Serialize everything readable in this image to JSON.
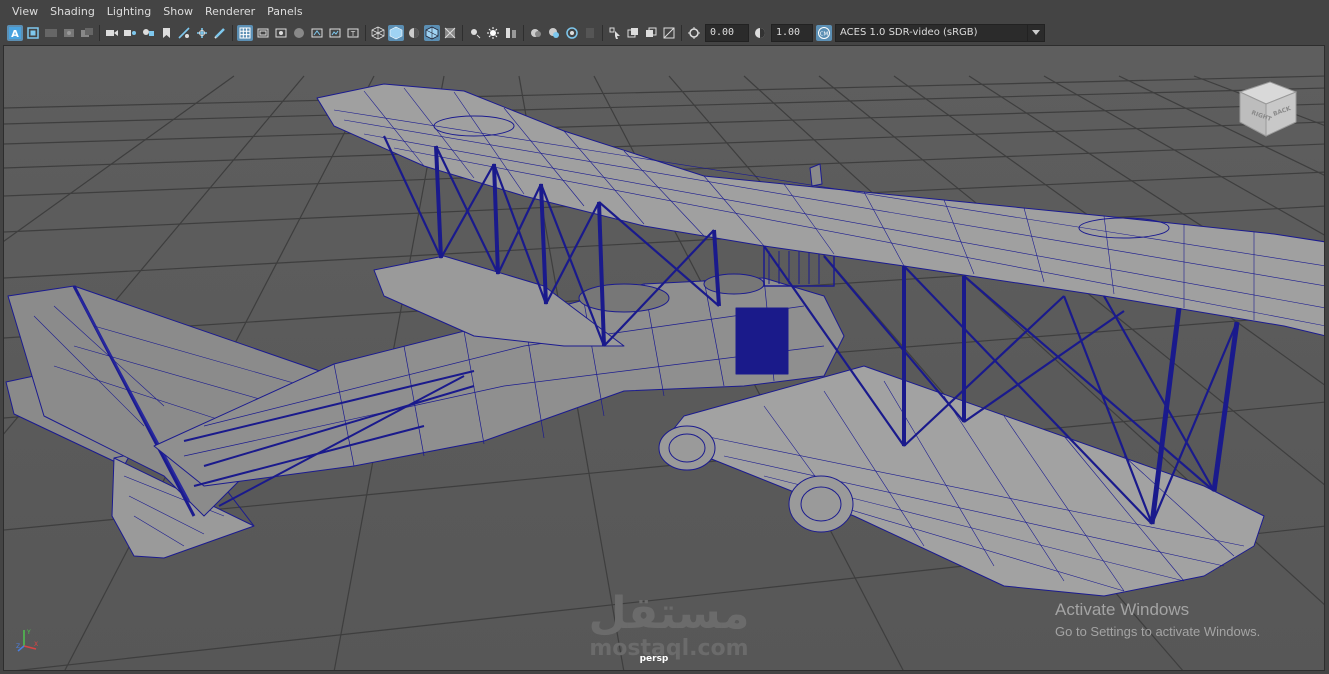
{
  "menu": {
    "items": [
      "View",
      "Shading",
      "Lighting",
      "Show",
      "Renderer",
      "Panels"
    ]
  },
  "toolbar": {
    "exposure_value": "0.00",
    "gamma_value": "1.00",
    "colorspace_value": "ACES 1.0 SDR-video (sRGB)",
    "icons": [
      "camera-select-icon",
      "camera-attributes-icon",
      "bookmark-icon",
      "image-plane-icon",
      "2d-pan-icon",
      "grease-pencil-icon",
      "grid-icon",
      "film-gate-icon",
      "resolution-gate-icon",
      "gate-mask-icon",
      "field-chart-icon",
      "safe-action-icon",
      "safe-title-icon",
      "wireframe-icon",
      "smooth-shade-icon",
      "default-material-icon",
      "wireframe-on-shaded-icon",
      "xray-icon",
      "use-all-lights-icon",
      "shadows-icon",
      "ambient-occlusion-icon",
      "motion-blur-icon",
      "antialiasing-icon",
      "depth-of-field-icon",
      "isolate-select-icon",
      "xray-joints-icon",
      "xray-active-icon",
      "backface-culling-icon",
      "exposure-icon",
      "gamma-icon",
      "color-management-icon"
    ]
  },
  "viewport": {
    "camera": "persp",
    "viewcube_faces": [
      "RIGHT",
      "BACK"
    ],
    "background_color": "#5a5a5a",
    "grid_color": "#3c3c3c",
    "wire_color": "#1a1a8c"
  },
  "overlay": {
    "activate_title": "Activate Windows",
    "activate_subtitle": "Go to Settings to activate Windows.",
    "watermark_arabic": "مستقل",
    "watermark_latin": "mostaql.com"
  }
}
